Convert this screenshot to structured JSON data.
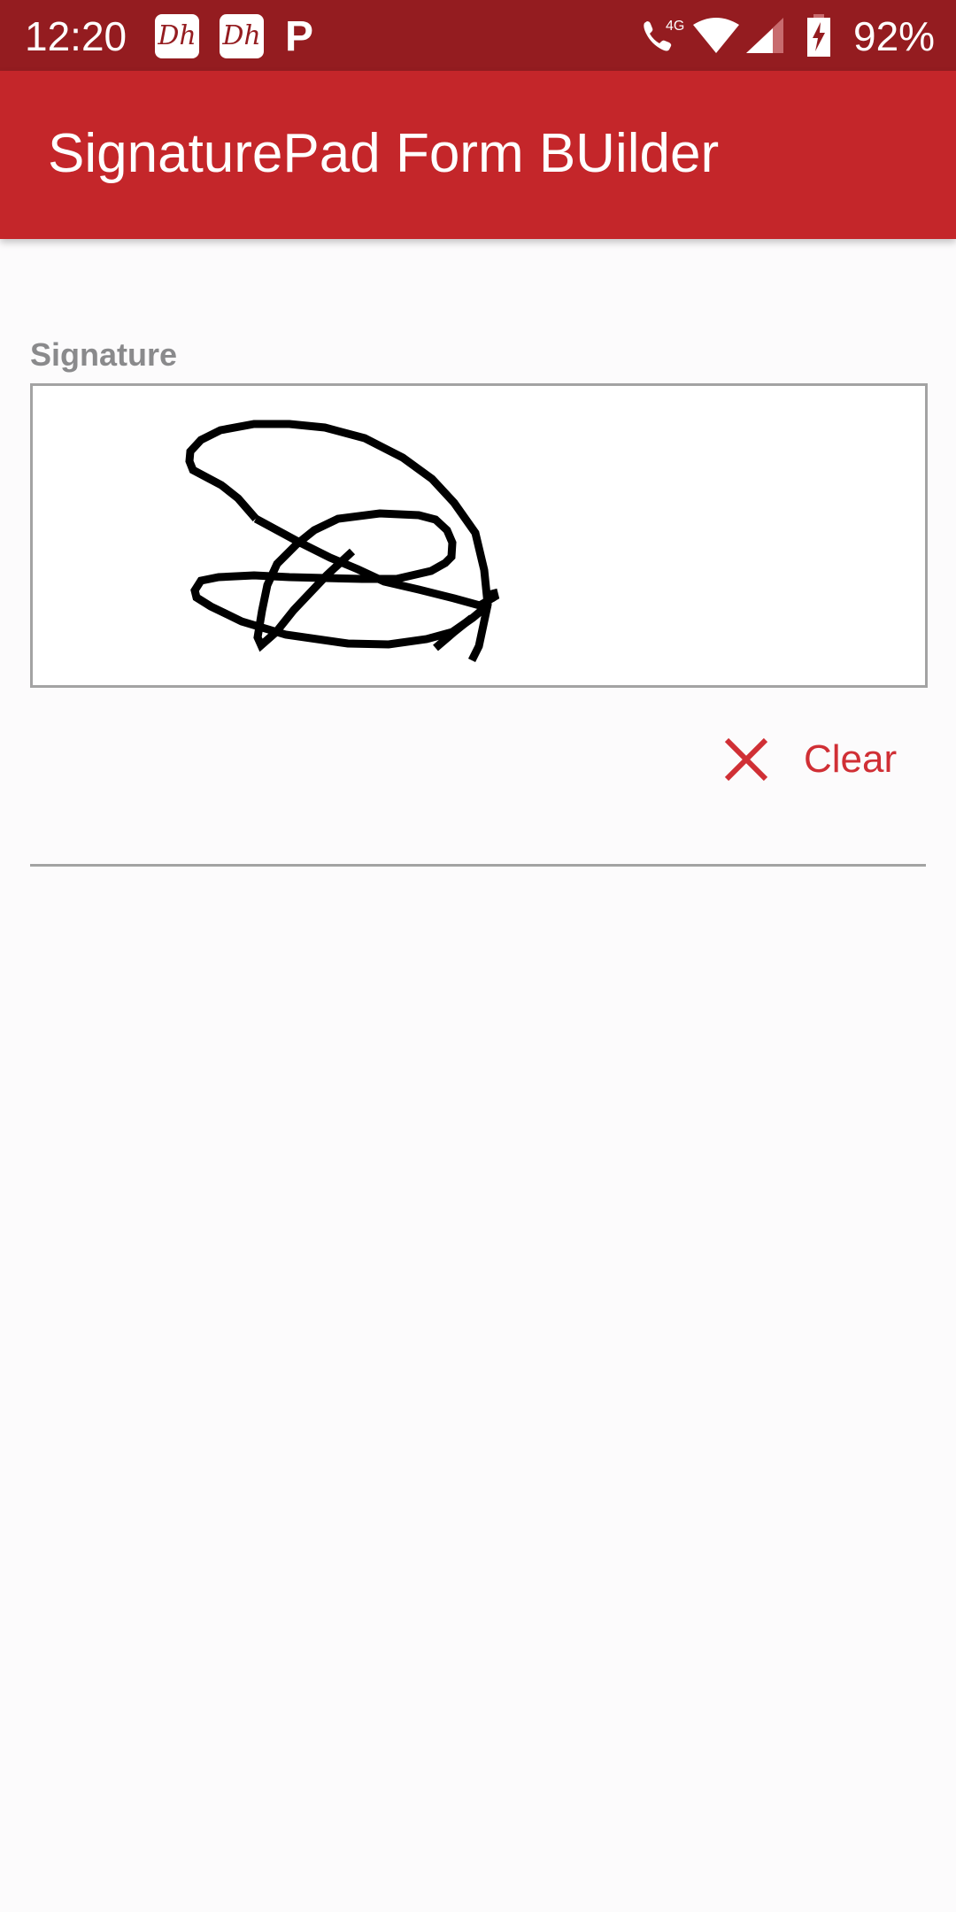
{
  "status_bar": {
    "time": "12:20",
    "notification_icons": [
      "disney-hotstar-icon",
      "disney-hotstar-icon",
      "p-app-icon"
    ],
    "notification_glyph": "Dh",
    "p_glyph": "P",
    "network_label": "4G",
    "battery_percent": "92%"
  },
  "app_bar": {
    "title": "SignaturePad Form BUilder",
    "color": "#c4262a"
  },
  "form": {
    "signature_label": "Signature",
    "signature_pad": {
      "has_signature": true,
      "stroke_color": "#000000"
    },
    "clear_button": {
      "label": "Clear",
      "icon": "close-icon",
      "color": "#d02f35"
    }
  }
}
